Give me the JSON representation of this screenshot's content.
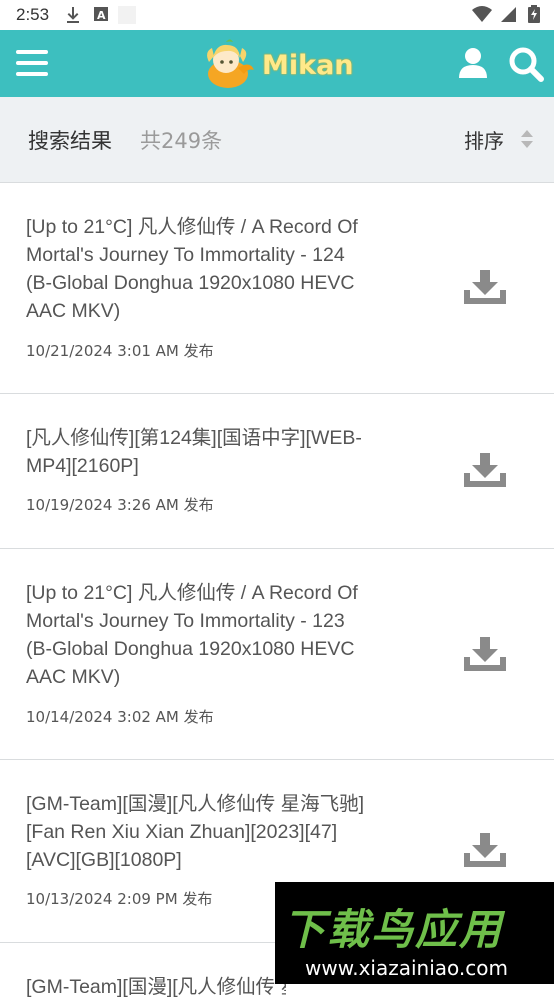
{
  "status_bar": {
    "time": "2:53",
    "left_icons": [
      "download-icon",
      "text-a-icon",
      "blank-icon"
    ],
    "right_icons": [
      "wifi-icon",
      "cell-signal-icon",
      "battery-icon"
    ]
  },
  "app_bar": {
    "logo_text": "Mikan",
    "background": "#3dbfbf"
  },
  "results": {
    "title": "搜索结果",
    "count": "共249条",
    "sort_label": "排序"
  },
  "items": [
    {
      "title": "[Up to 21°C] 凡人修仙传 / A Record Of Mortal's Journey To Immortality - 124 (B-Global Donghua 1920x1080 HEVC AAC MKV)",
      "date": "10/21/2024 3:01 AM 发布"
    },
    {
      "title": "[凡人修仙传][第124集][国语中字][WEB-MP4][2160P]",
      "date": "10/19/2024 3:26 AM 发布"
    },
    {
      "title": "[Up to 21°C] 凡人修仙传 / A Record Of Mortal's Journey To Immortality - 123 (B-Global Donghua 1920x1080 HEVC AAC MKV)",
      "date": "10/14/2024 3:02 AM 发布"
    },
    {
      "title": "[GM-Team][国漫][凡人修仙传 星海飞驰][Fan Ren Xiu Xian Zhuan][2023][47][AVC][GB][1080P]",
      "date": "10/13/2024 2:09 PM 发布"
    },
    {
      "title": "[GM-Team][国漫][凡人修仙传 星海飞驰]",
      "date": ""
    }
  ],
  "watermark": {
    "main": "下载鸟应用",
    "url": "www.xiazainiao.com"
  }
}
